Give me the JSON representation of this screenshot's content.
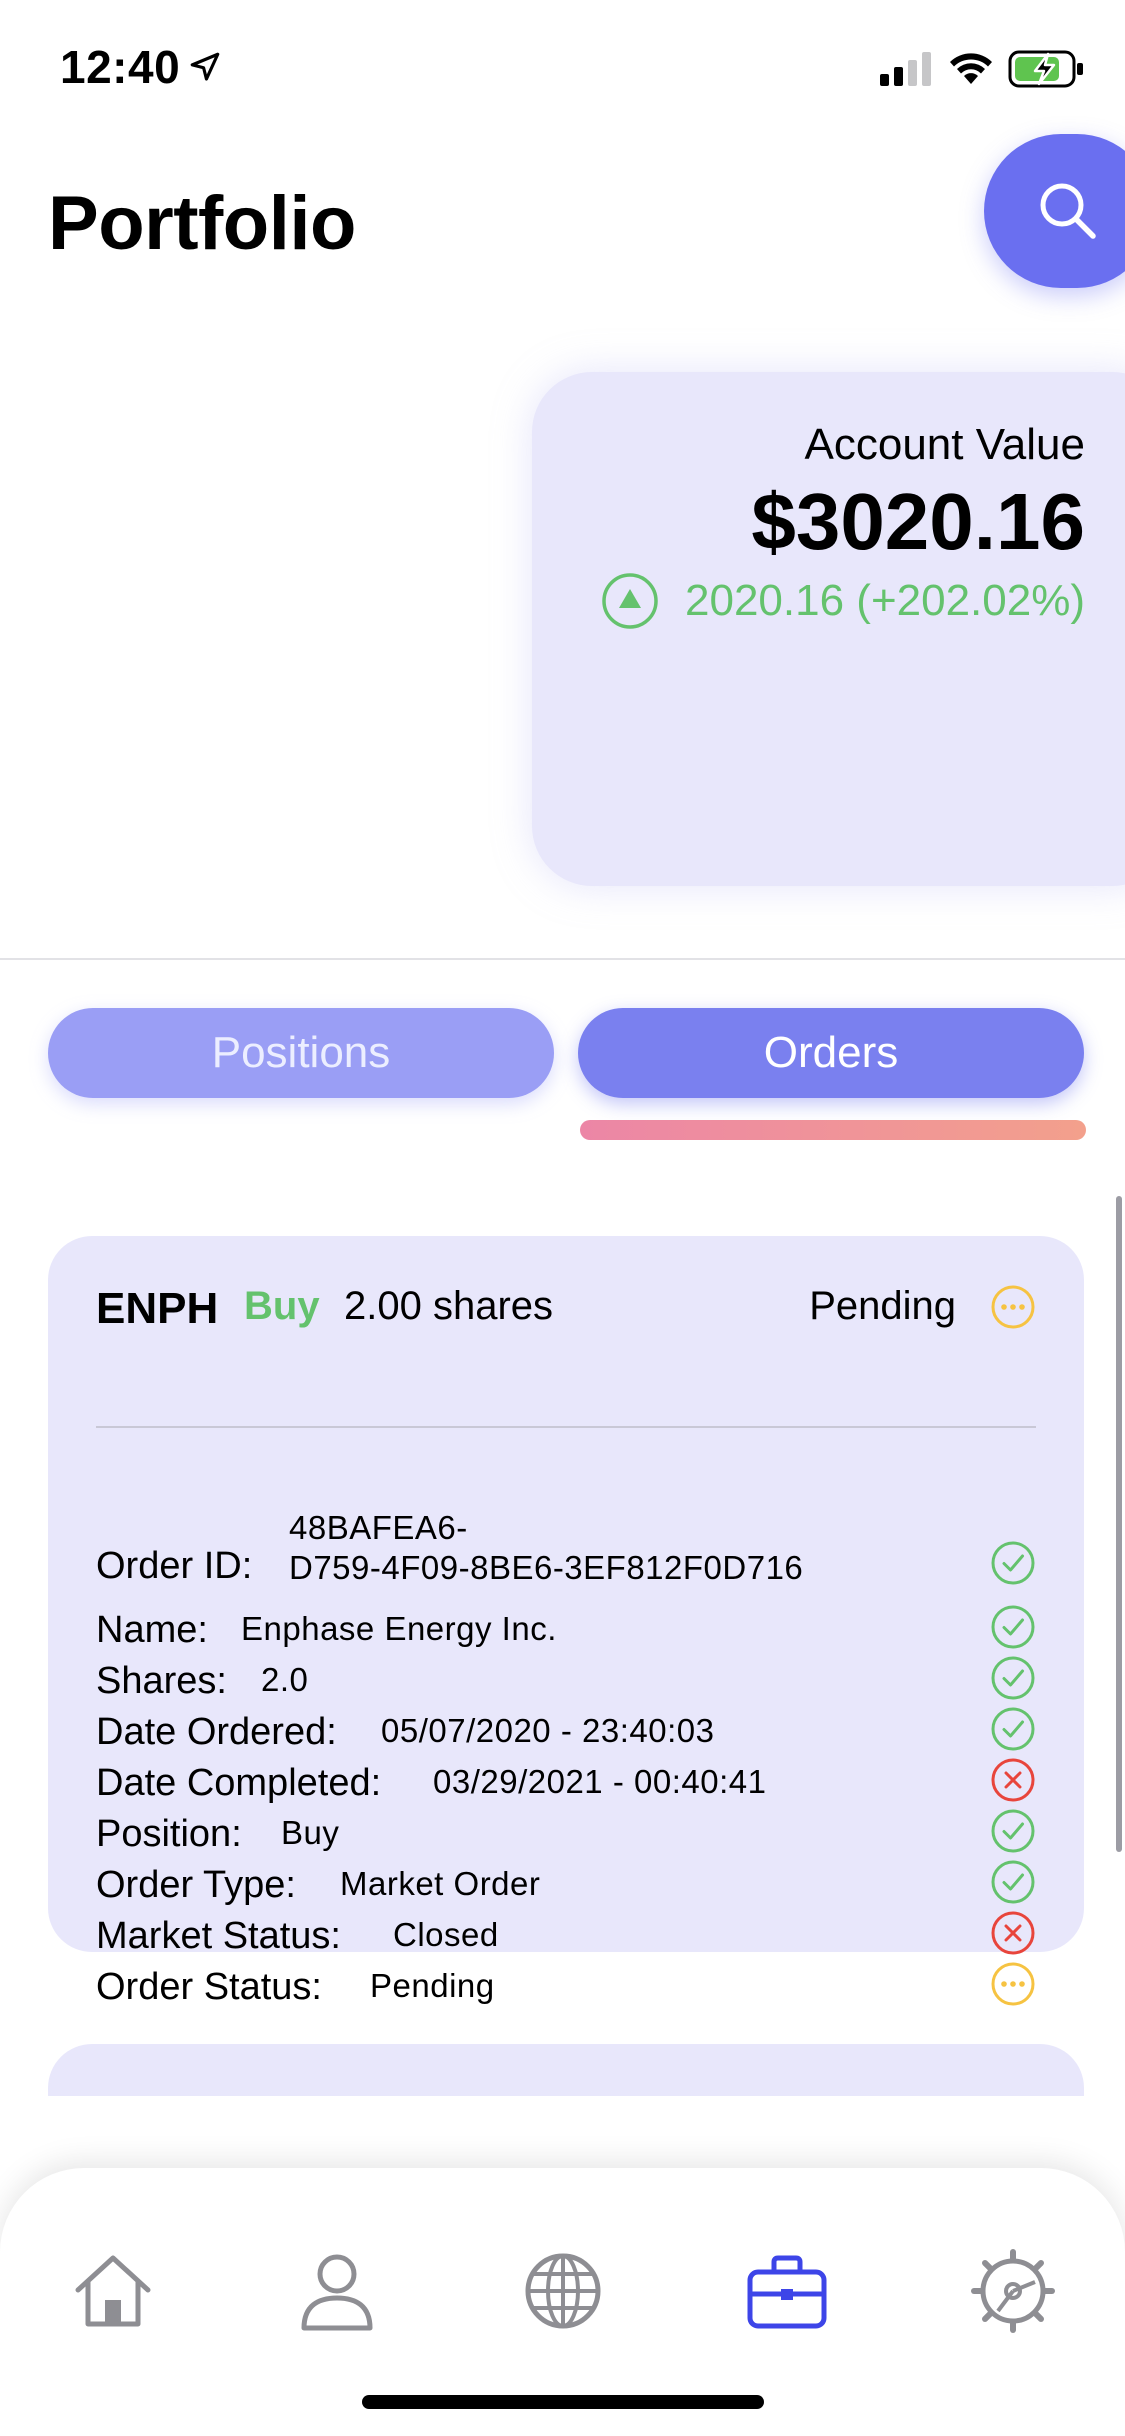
{
  "status_bar": {
    "time": "12:40",
    "icons": [
      "location-arrow-icon",
      "cellular-signal-icon",
      "wifi-icon",
      "battery-charging-icon"
    ]
  },
  "header": {
    "title": "Portfolio",
    "search_icon": "search-icon"
  },
  "account": {
    "label": "Account Value",
    "value": "$3020.16",
    "change": "2020.16 (+202.02%)",
    "change_icon": "triangle-up-circle-icon",
    "change_color": "#64c26d"
  },
  "tabs": [
    {
      "label": "Positions",
      "selected": false
    },
    {
      "label": "Orders",
      "selected": true
    }
  ],
  "orders": [
    {
      "symbol": "ENPH",
      "side": "Buy",
      "quantity": "2.00 shares",
      "status": "Pending",
      "status_icon": "pending-ellipsis-icon",
      "details": [
        {
          "label": "Order ID:",
          "value_line1": "48BAFEA6-",
          "value_line2": "D759-4F09-8BE6-3EF812F0D716",
          "icon": "check-circle-icon"
        },
        {
          "label": "Name:",
          "value": "Enphase Energy Inc.",
          "icon": "check-circle-icon"
        },
        {
          "label": "Shares:",
          "value": "2.0",
          "icon": "check-circle-icon"
        },
        {
          "label": "Date Ordered:",
          "value": "05/07/2020 - 23:40:03",
          "icon": "check-circle-icon"
        },
        {
          "label": "Date Completed:",
          "value": "03/29/2021 - 00:40:41",
          "icon": "x-circle-icon"
        },
        {
          "label": "Position:",
          "value": "Buy",
          "icon": "check-circle-icon"
        },
        {
          "label": "Order Type:",
          "value": "Market Order",
          "icon": "check-circle-icon"
        },
        {
          "label": "Market Status:",
          "value": "Closed",
          "icon": "x-circle-icon"
        },
        {
          "label": "Order Status:",
          "value": "Pending",
          "icon": "pending-ellipsis-icon"
        }
      ]
    }
  ],
  "tab_bar": {
    "items": [
      {
        "icon": "home-icon",
        "active": false
      },
      {
        "icon": "person-icon",
        "active": false
      },
      {
        "icon": "globe-icon",
        "active": false
      },
      {
        "icon": "briefcase-icon",
        "active": true
      },
      {
        "icon": "gear-icon",
        "active": false
      }
    ]
  },
  "colors": {
    "accent": "#6a6ff0",
    "card": "#e8e7fb",
    "positive": "#64c26d",
    "negative": "#e8453c",
    "pending": "#f6c342"
  }
}
